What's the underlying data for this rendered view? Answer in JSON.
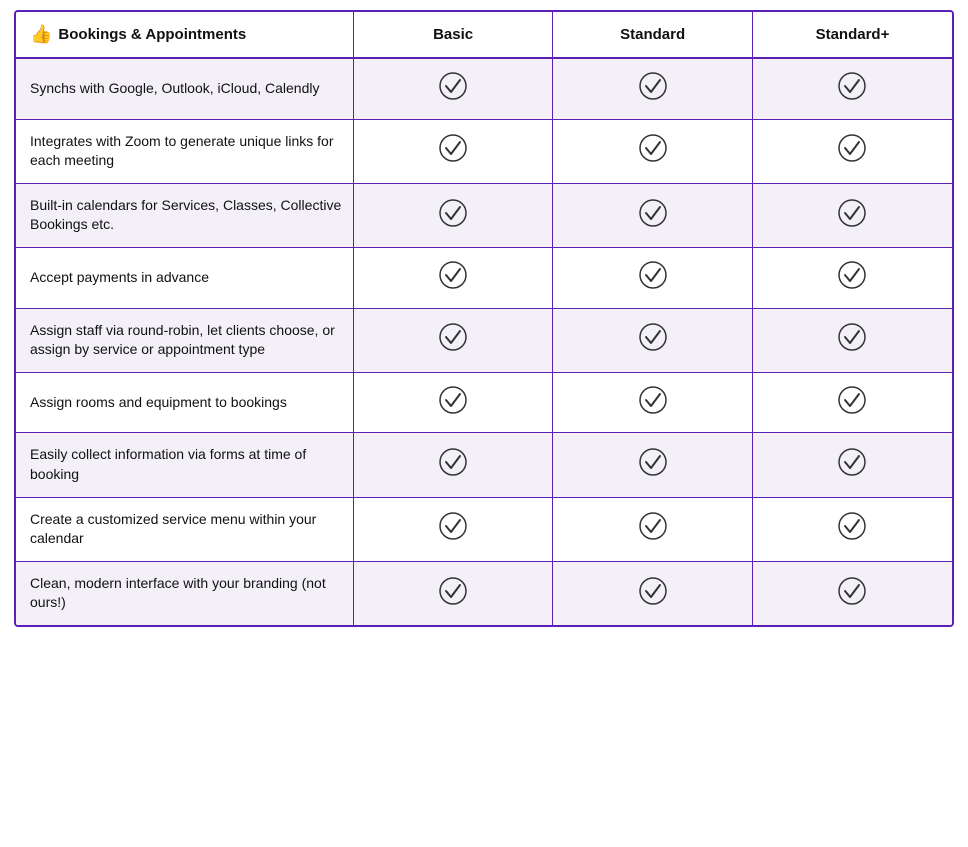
{
  "header": {
    "section_icon": "👍",
    "section_title": "Bookings & Appointments",
    "col_basic": "Basic",
    "col_standard": "Standard",
    "col_standard_plus": "Standard+"
  },
  "rows": [
    {
      "feature": "Synchs with Google, Outlook, iCloud, Calendly",
      "basic": true,
      "standard": true,
      "standard_plus": true
    },
    {
      "feature": "Integrates with Zoom to generate unique links for each meeting",
      "basic": true,
      "standard": true,
      "standard_plus": true
    },
    {
      "feature": "Built-in calendars for Services, Classes, Collective Bookings etc.",
      "basic": true,
      "standard": true,
      "standard_plus": true
    },
    {
      "feature": "Accept payments in advance",
      "basic": true,
      "standard": true,
      "standard_plus": true
    },
    {
      "feature": "Assign staff via round-robin, let clients choose, or assign by service or appointment type",
      "basic": true,
      "standard": true,
      "standard_plus": true
    },
    {
      "feature": "Assign rooms and equipment to bookings",
      "basic": true,
      "standard": true,
      "standard_plus": true
    },
    {
      "feature": "Easily collect information via forms at time of booking",
      "basic": true,
      "standard": true,
      "standard_plus": true
    },
    {
      "feature": "Create a customized service menu within your calendar",
      "basic": true,
      "standard": true,
      "standard_plus": true
    },
    {
      "feature": "Clean, modern interface with your branding (not ours!)",
      "basic": true,
      "standard": true,
      "standard_plus": true
    }
  ],
  "checkmark_symbol": "✓"
}
